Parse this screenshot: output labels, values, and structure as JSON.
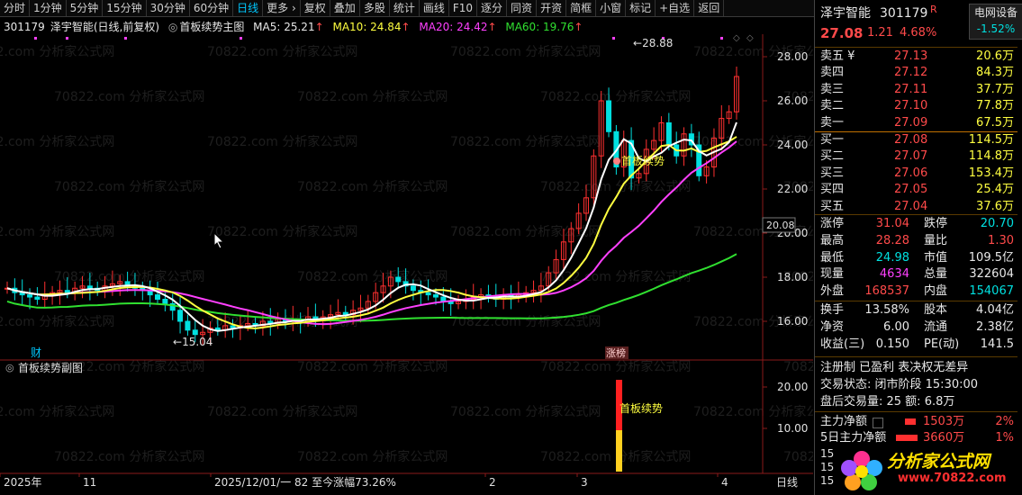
{
  "toolbar": {
    "items": [
      "分时",
      "1分钟",
      "5分钟",
      "15分钟",
      "30分钟",
      "60分钟",
      "日线",
      "更多 ›",
      "复权",
      "叠加",
      "多股",
      "统计",
      "画线",
      "F10",
      "逐分",
      "同资",
      "开资",
      "简框",
      "小窗",
      "标记",
      "+自选",
      "返回"
    ],
    "active": "日线"
  },
  "header": {
    "code": "301179",
    "name": "泽宇智能",
    "period": "(日线,前复权)",
    "indicator": "首板续势主图",
    "ma5": "MA5: 25.21",
    "ma10": "MA10: 24.84",
    "ma20": "MA20: 24.42",
    "ma60": "MA60: 19.76"
  },
  "colors": {
    "up": "#ff3030",
    "down": "#00e0e0",
    "ma5": "#ffffff",
    "ma10": "#ffff40",
    "ma20": "#ff40ff",
    "ma60": "#30e030"
  },
  "main_chart": {
    "y_ticks": [
      "28.00",
      "26.00",
      "24.00",
      "22.00",
      "20.00",
      "18.00",
      "16.00"
    ],
    "current_price_tag": "20.08",
    "high_marker": "28.88",
    "low_marker": "15.04",
    "signal_label": "首板续势",
    "bottom_tag_fin": "财",
    "bottom_tag_zt": "涨榜",
    "watermark": "70822.com 分析家公式网"
  },
  "sub_chart": {
    "title": "首板续势副图",
    "y_ticks": [
      "20.00",
      "10.00"
    ],
    "signal_label": "首板续势"
  },
  "x_axis": {
    "labels": [
      "2025年",
      "11",
      "2025/12/01/一 82 至今涨幅73.26%",
      "2",
      "3",
      "4"
    ],
    "period_button": "日线"
  },
  "quote": {
    "name": "泽宇智能",
    "code": "301179",
    "badge": "R",
    "sector": "电网设备",
    "sector_change": "-1.52%",
    "price": "27.08",
    "change": "1.21",
    "change_pct": "4.68%",
    "asks": [
      {
        "label": "卖五 ¥",
        "price": "27.13",
        "vol": "20.6万"
      },
      {
        "label": "卖四",
        "price": "27.12",
        "vol": "84.3万"
      },
      {
        "label": "卖三",
        "price": "27.11",
        "vol": "37.7万"
      },
      {
        "label": "卖二",
        "price": "27.10",
        "vol": "77.8万"
      },
      {
        "label": "卖一",
        "price": "27.09",
        "vol": "67.5万"
      }
    ],
    "bids": [
      {
        "label": "买一",
        "price": "27.08",
        "vol": "114.5万"
      },
      {
        "label": "买二",
        "price": "27.07",
        "vol": "114.8万"
      },
      {
        "label": "买三",
        "price": "27.06",
        "vol": "153.4万"
      },
      {
        "label": "买四",
        "price": "27.05",
        "vol": "25.4万"
      },
      {
        "label": "买五",
        "price": "27.04",
        "vol": "37.6万"
      }
    ],
    "stats": [
      {
        "l1": "涨停",
        "v1": "31.04",
        "l2": "跌停",
        "v2": "20.70"
      },
      {
        "l1": "最高",
        "v1": "28.28",
        "l2": "量比",
        "v2": "1.30"
      },
      {
        "l1": "最低",
        "v1": "24.98",
        "l2": "市值",
        "v2": "109.5亿"
      },
      {
        "l1": "现量",
        "v1": "4634",
        "l2": "总量",
        "v2": "322604"
      },
      {
        "l1": "外盘",
        "v1": "168537",
        "l2": "内盘",
        "v2": "154067"
      }
    ],
    "fund": [
      {
        "l1": "换手",
        "v1": "13.58%",
        "l2": "股本",
        "v2": "4.04亿"
      },
      {
        "l1": "净资",
        "v1": "6.00",
        "l2": "流通",
        "v2": "2.38亿"
      },
      {
        "l1": "收益(三)",
        "v1": "0.150",
        "l2": "PE(动)",
        "v2": "141.5"
      }
    ],
    "notes": "注册制 已盈利 表决权无差异",
    "trade_status": "交易状态: 闭市阶段 15:30:00",
    "after_hours": "盘后交易量: 25  额: 6.8万",
    "main_flow_label": "主力净额",
    "main_flow_value": "1503万",
    "main_flow_pct": "2%",
    "flow5_label": "5日主力净额",
    "flow5_value": "3660万",
    "flow5_pct": "1%",
    "logo_text": "分析家公式网",
    "logo_url": "www.70822.com",
    "tail_nums": [
      "15",
      "15",
      "15"
    ]
  }
}
